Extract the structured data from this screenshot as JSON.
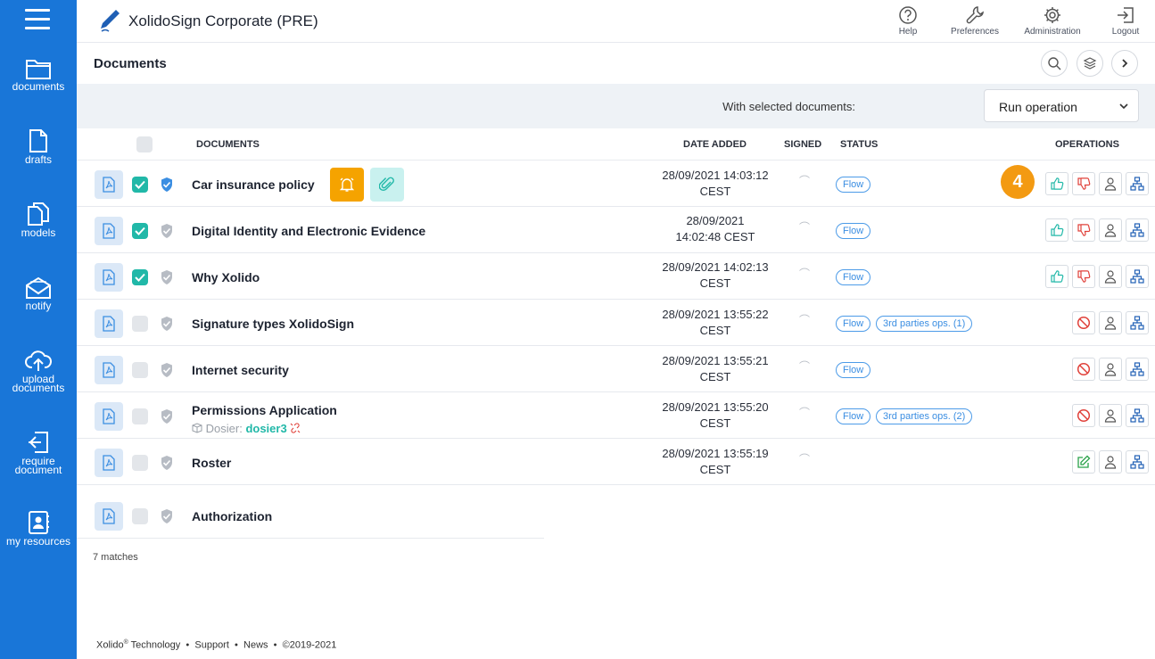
{
  "app": {
    "title": "XolidoSign Corporate (PRE)"
  },
  "sidebar": {
    "items": [
      {
        "label": "documents"
      },
      {
        "label": "drafts"
      },
      {
        "label": "models"
      },
      {
        "label": "notify"
      },
      {
        "label": "upload documents"
      },
      {
        "label": "require document"
      },
      {
        "label": "my resources"
      }
    ]
  },
  "top_actions": [
    {
      "label": "Help",
      "icon": "help-icon"
    },
    {
      "label": "Preferences",
      "icon": "wrench-icon"
    },
    {
      "label": "Administration",
      "icon": "gear-icon"
    },
    {
      "label": "Logout",
      "icon": "logout-icon"
    }
  ],
  "page": {
    "title": "Documents"
  },
  "bulk": {
    "label": "With selected documents:",
    "select_value": "Run operation"
  },
  "table": {
    "headers": {
      "documents": "DOCUMENTS",
      "date_added": "DATE ADDED",
      "signed": "SIGNED",
      "status": "STATUS",
      "operations": "OPERATIONS"
    },
    "rows": [
      {
        "name": "Car insurance policy",
        "date_line1": "28/09/2021 14:03:12",
        "date_line2": "CEST",
        "checked": true,
        "tags": [
          "Flow"
        ]
      },
      {
        "name": "Digital Identity and Electronic Evidence",
        "date_line1": "28/09/2021",
        "date_line2": "14:02:48 CEST",
        "checked": true,
        "tags": [
          "Flow"
        ]
      },
      {
        "name": "Why Xolido",
        "date_line1": "28/09/2021 14:02:13",
        "date_line2": "CEST",
        "checked": true,
        "tags": [
          "Flow"
        ]
      },
      {
        "name": "Signature types XolidoSign",
        "date_line1": "28/09/2021 13:55:22",
        "date_line2": "CEST",
        "checked": false,
        "tags": [
          "Flow",
          "3rd parties ops. (1)"
        ]
      },
      {
        "name": "Internet security",
        "date_line1": "28/09/2021 13:55:21",
        "date_line2": "CEST",
        "checked": false,
        "tags": [
          "Flow"
        ]
      },
      {
        "name": "Permissions Application",
        "dosier_label": "Dosier:",
        "dosier_value": "dosier3",
        "date_line1": "28/09/2021 13:55:20",
        "date_line2": "CEST",
        "checked": false,
        "tags": [
          "Flow",
          "3rd parties ops. (2)"
        ]
      },
      {
        "name": "Roster",
        "date_line1": "28/09/2021 13:55:19",
        "date_line2": "CEST",
        "checked": false,
        "tags": []
      },
      {
        "name": "Authorization",
        "checked": false,
        "tags": []
      }
    ]
  },
  "tour_badge": "4",
  "matches": "7 matches",
  "footer": {
    "brand": "Xolido",
    "brand_sup": "®",
    "brand_rest": " Technology",
    "support": "Support",
    "news": "News",
    "copyright": "©2019-2021",
    "sep": "•"
  },
  "colors": {
    "sidebar": "#1976d8",
    "accent": "#21b8a8",
    "badge": "#f39a12",
    "bell": "#f5a300"
  }
}
